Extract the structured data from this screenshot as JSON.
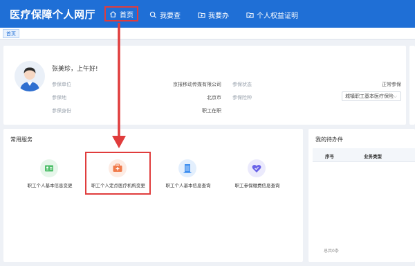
{
  "header": {
    "brand": "医疗保障个人网厅",
    "nav": [
      {
        "label": "首页",
        "icon": "home-icon"
      },
      {
        "label": "我要查",
        "icon": "search-icon"
      },
      {
        "label": "我要办",
        "icon": "folder-icon"
      },
      {
        "label": "个人权益证明",
        "icon": "document-folder-icon"
      }
    ]
  },
  "tabs": {
    "home": "首页"
  },
  "profile": {
    "greeting": "张美珍，上午好!",
    "fields": [
      {
        "label": "参保单位",
        "value": "京报移动传媒有限公司"
      },
      {
        "label": "参保地",
        "value": "北京市"
      },
      {
        "label": "参保身份",
        "value": "职工在职"
      },
      {
        "label": "参保状态",
        "value": "正常参保"
      },
      {
        "label": "参保险种",
        "value": "城镇职工基本医疗保险"
      }
    ]
  },
  "services": {
    "title": "常用服务",
    "items": [
      {
        "label": "职工个人基本信息变更",
        "icon": "id-card-icon",
        "color": "#4fbf6a",
        "bg": "#e6f6ea"
      },
      {
        "label": "职工个人定点医疗机构变更",
        "icon": "medical-kit-icon",
        "color": "#f07a4a",
        "bg": "#fdece4"
      },
      {
        "label": "职工个人基本信息查询",
        "icon": "building-icon",
        "color": "#3d8ef0",
        "bg": "#e3effd"
      },
      {
        "label": "职工参保缴费信息查询",
        "icon": "heart-check-icon",
        "color": "#6a63e8",
        "bg": "#ebeafc"
      }
    ]
  },
  "todo": {
    "title": "我的待办件",
    "col_index": "序号",
    "col_type": "业务类型",
    "total": "总共0条"
  },
  "colors": {
    "brand_blue": "#1f6fd6",
    "highlight_red": "#e03c3c"
  }
}
